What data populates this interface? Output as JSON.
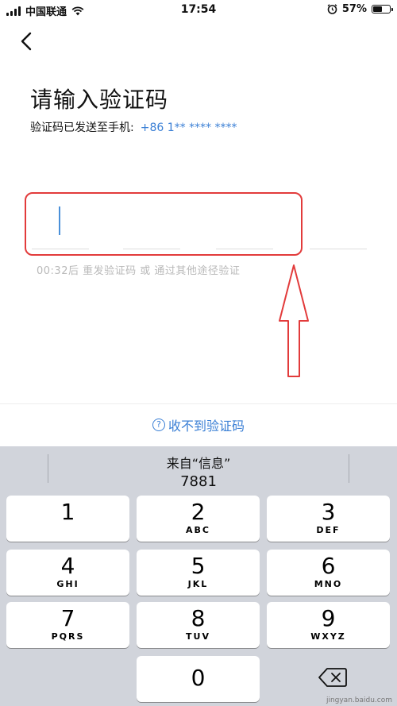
{
  "status_bar": {
    "carrier": "中国联通",
    "time": "17:54",
    "battery_percent": "57%",
    "battery_level": 0.57
  },
  "page": {
    "title": "请输入验证码",
    "subtitle": "验证码已发送至手机:",
    "phone": "+86 1** **** ****",
    "resend_text": "00:32后  重发验证码  或  通过其他途径验证",
    "help_text": "收不到验证码",
    "code_slots": [
      "",
      "",
      "",
      "",
      "",
      ""
    ]
  },
  "keyboard": {
    "suggestion_label": "来自“信息”",
    "suggestion_code": "7881",
    "keys": [
      {
        "num": "1",
        "letters": ""
      },
      {
        "num": "2",
        "letters": "ABC"
      },
      {
        "num": "3",
        "letters": "DEF"
      },
      {
        "num": "4",
        "letters": "GHI"
      },
      {
        "num": "5",
        "letters": "JKL"
      },
      {
        "num": "6",
        "letters": "MNO"
      },
      {
        "num": "7",
        "letters": "PQRS"
      },
      {
        "num": "8",
        "letters": "TUV"
      },
      {
        "num": "9",
        "letters": "WXYZ"
      },
      {
        "num": "0",
        "letters": ""
      }
    ]
  },
  "watermark": "jingyan.baidu.com",
  "colors": {
    "accent": "#3a7fd5",
    "annotation": "#e23b3b",
    "keyboard_bg": "#d1d4db"
  }
}
